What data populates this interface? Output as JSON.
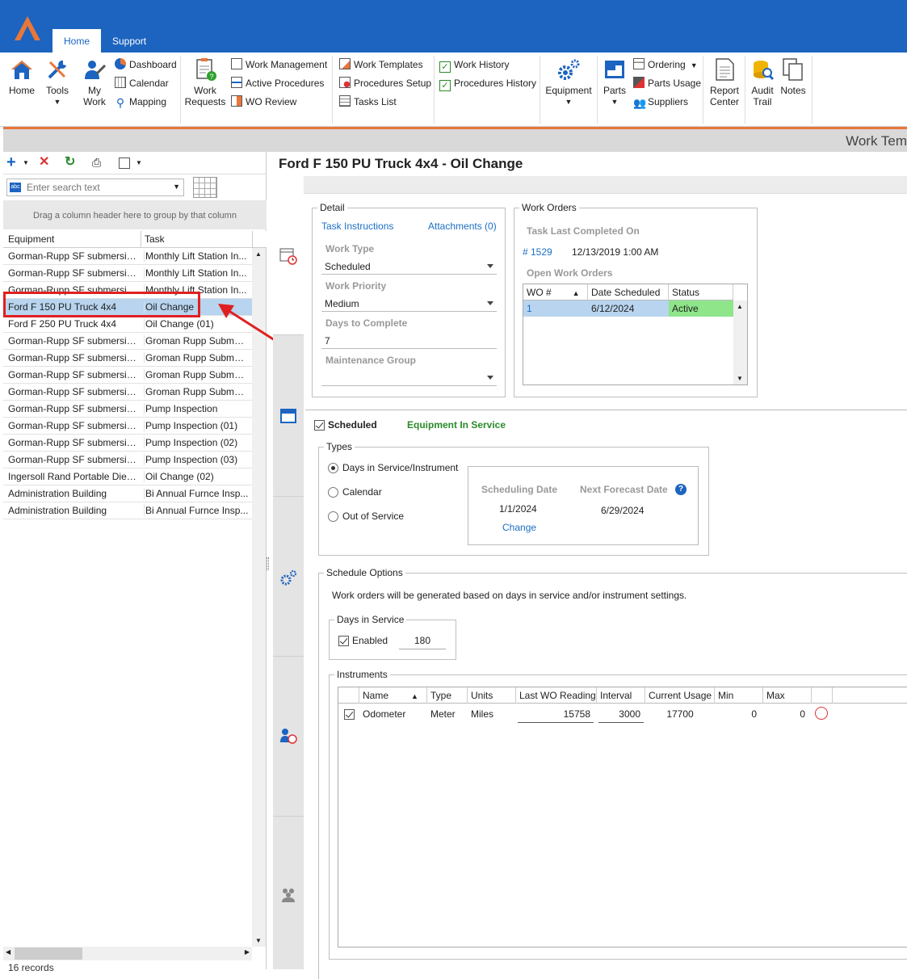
{
  "tabs": {
    "home": "Home",
    "support": "Support"
  },
  "ribbon": {
    "home": "Home",
    "tools": "Tools",
    "my_work": "My\nWork",
    "dashboard": "Dashboard",
    "calendar": "Calendar",
    "mapping": "Mapping",
    "work_requests": "Work\nRequests",
    "work_management": "Work Management",
    "active_procedures": "Active Procedures",
    "wo_review": "WO Review",
    "work_templates": "Work Templates",
    "procedures_setup": "Procedures Setup",
    "tasks_list": "Tasks List",
    "work_history": "Work History",
    "procedures_history": "Procedures History",
    "equipment": "Equipment",
    "parts": "Parts",
    "ordering": "Ordering",
    "parts_usage": "Parts Usage",
    "suppliers": "Suppliers",
    "report_center": "Report\nCenter",
    "audit_trail": "Audit\nTrail",
    "notes": "Notes"
  },
  "subbar_title": "Work Tem",
  "left": {
    "search_placeholder": "Enter search text",
    "group_hint": "Drag a column header here to group by that column",
    "columns": {
      "equipment": "Equipment",
      "task": "Task"
    },
    "rows": [
      {
        "equipment": "Gorman-Rupp SF submersib...",
        "task": "Monthly Lift Station In..."
      },
      {
        "equipment": "Gorman-Rupp SF submersib...",
        "task": "Monthly Lift Station In..."
      },
      {
        "equipment": "Gorman-Rupp SF submersib...",
        "task": "Monthly Lift Station In..."
      },
      {
        "equipment": "Ford F 150 PU Truck 4x4",
        "task": "Oil Change"
      },
      {
        "equipment": "Ford F 250 PU Truck 4x4",
        "task": "Oil Change (01)"
      },
      {
        "equipment": "Gorman-Rupp SF submersib...",
        "task": "Groman Rupp Submer..."
      },
      {
        "equipment": "Gorman-Rupp SF submersib...",
        "task": "Groman Rupp Submer..."
      },
      {
        "equipment": "Gorman-Rupp SF submersib...",
        "task": "Groman Rupp Submer..."
      },
      {
        "equipment": "Gorman-Rupp SF submersib...",
        "task": "Groman Rupp Submer..."
      },
      {
        "equipment": "Gorman-Rupp SF submersib...",
        "task": "Pump Inspection"
      },
      {
        "equipment": "Gorman-Rupp SF submersib...",
        "task": "Pump Inspection (01)"
      },
      {
        "equipment": "Gorman-Rupp SF submersib...",
        "task": "Pump Inspection (02)"
      },
      {
        "equipment": "Gorman-Rupp SF submersib...",
        "task": "Pump Inspection (03)"
      },
      {
        "equipment": "Ingersoll Rand Portable Dies...",
        "task": "Oil Change (02)"
      },
      {
        "equipment": "Administration Building",
        "task": "Bi Annual Furnce Insp..."
      },
      {
        "equipment": "Administration Building",
        "task": "Bi Annual Furnce Insp..."
      }
    ],
    "selected_index": 3,
    "records": "16 records"
  },
  "right": {
    "title": "Ford F 150 PU Truck 4x4 - Oil Change",
    "detail": {
      "legend": "Detail",
      "task_instructions": "Task Instructions",
      "attachments": "Attachments (0)",
      "work_type_label": "Work Type",
      "work_type": "Scheduled",
      "work_priority_label": "Work Priority",
      "work_priority": "Medium",
      "days_label": "Days to Complete",
      "days": "7",
      "maint_group_label": "Maintenance Group",
      "maint_group": ""
    },
    "work_orders": {
      "legend": "Work Orders",
      "last_completed_label": "Task Last Completed On",
      "last_wo": "# 1529",
      "last_date": "12/13/2019 1:00 AM",
      "open_label": "Open Work Orders",
      "cols": {
        "wo": "WO #",
        "date": "Date Scheduled",
        "status": "Status"
      },
      "rows": [
        {
          "wo": "1",
          "date": "6/12/2024",
          "status": "Active"
        }
      ]
    },
    "schedule": {
      "scheduled_label": "Scheduled",
      "in_service": "Equipment In Service",
      "types_legend": "Types",
      "opt_days": "Days in Service/Instrument",
      "opt_calendar": "Calendar",
      "opt_oos": "Out of Service",
      "sched_date_label": "Scheduling Date",
      "next_date_label": "Next Forecast Date",
      "sched_date": "1/1/2024",
      "next_date": "6/29/2024",
      "change": "Change",
      "options_legend": "Schedule Options",
      "options_text": "Work orders will be generated based on days in service and/or instrument settings.",
      "dis_legend": "Days in Service",
      "enabled": "Enabled",
      "dis_value": "180",
      "instr_legend": "Instruments",
      "instr_cols": {
        "name": "Name",
        "type": "Type",
        "units": "Units",
        "last": "Last WO Reading",
        "interval": "Interval",
        "current": "Current Usage",
        "min": "Min",
        "max": "Max"
      },
      "instr_rows": [
        {
          "name": "Odometer",
          "type": "Meter",
          "units": "Miles",
          "last": "15758",
          "interval": "3000",
          "current": "17700",
          "min": "0",
          "max": "0"
        }
      ]
    }
  },
  "colors": {
    "brand_blue": "#1c64c0",
    "accent_orange": "#e8773a",
    "highlight_red": "#e02020",
    "active_green": "#8ee58a",
    "link_blue": "#1c6fc4",
    "ok_green": "#2a8a2a"
  }
}
